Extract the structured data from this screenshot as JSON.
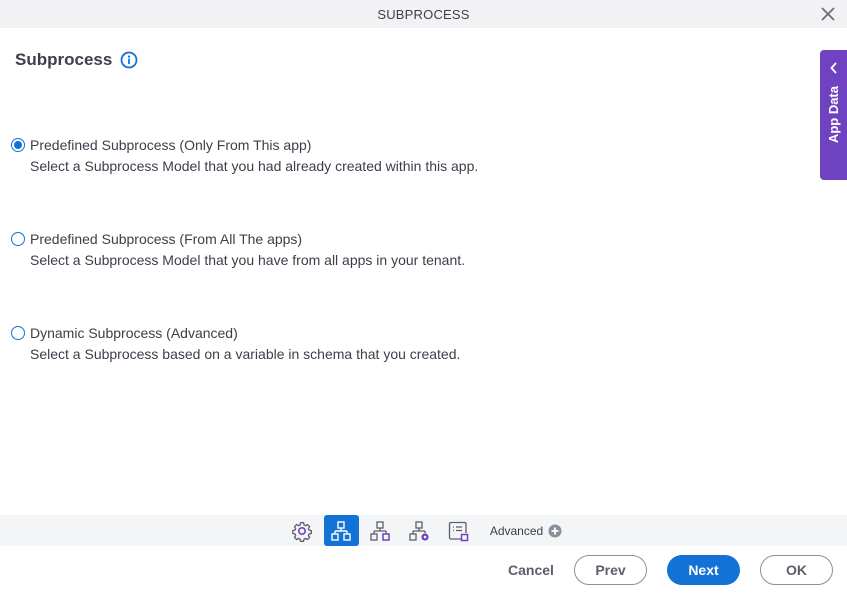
{
  "window": {
    "title": "SUBPROCESS",
    "close_icon": "close-icon"
  },
  "heading": {
    "title": "Subprocess",
    "info_icon": "info-icon"
  },
  "options": [
    {
      "label": "Predefined Subprocess (Only From This app)",
      "description": "Select a Subprocess Model that you had already created within this app.",
      "selected": true
    },
    {
      "label": "Predefined Subprocess (From All The apps)",
      "description": "Select a Subprocess Model that you have from all apps in your tenant.",
      "selected": false
    },
    {
      "label": "Dynamic Subprocess (Advanced)",
      "description": "Select a Subprocess based on a variable in schema that you created.",
      "selected": false
    }
  ],
  "side_panel": {
    "label": "App Data",
    "icon": "chevron-left-icon"
  },
  "toolbar": {
    "items": [
      {
        "name": "general-settings",
        "icon": "gear-icon",
        "active": false
      },
      {
        "name": "subprocess-config",
        "icon": "hierarchy-icon",
        "active": true
      },
      {
        "name": "data-mapping",
        "icon": "hierarchy-square-icon",
        "active": false
      },
      {
        "name": "advanced-settings",
        "icon": "hierarchy-gear-icon",
        "active": false
      },
      {
        "name": "list-settings",
        "icon": "list-box-icon",
        "active": false
      }
    ],
    "advanced_label": "Advanced",
    "advanced_icon": "plus-circle-icon"
  },
  "footer": {
    "cancel_label": "Cancel",
    "prev_label": "Prev",
    "next_label": "Next",
    "ok_label": "OK"
  },
  "colors": {
    "primary": "#1272d6",
    "accent_purple": "#6f42c1",
    "text": "#3b3f4a"
  }
}
